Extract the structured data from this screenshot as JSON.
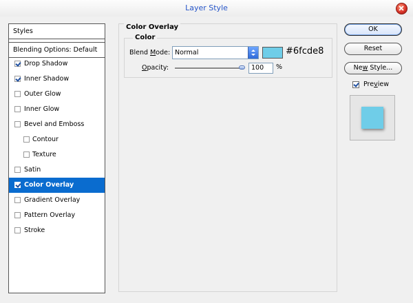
{
  "window": {
    "title": "Layer Style"
  },
  "styles_panel": {
    "header": "Styles",
    "blending_options": "Blending Options: Default",
    "items": [
      {
        "label": "Drop Shadow",
        "checked": true,
        "indent": false,
        "selected": false
      },
      {
        "label": "Inner Shadow",
        "checked": true,
        "indent": false,
        "selected": false
      },
      {
        "label": "Outer Glow",
        "checked": false,
        "indent": false,
        "selected": false
      },
      {
        "label": "Inner Glow",
        "checked": false,
        "indent": false,
        "selected": false
      },
      {
        "label": "Bevel and Emboss",
        "checked": false,
        "indent": false,
        "selected": false
      },
      {
        "label": "Contour",
        "checked": false,
        "indent": true,
        "selected": false
      },
      {
        "label": "Texture",
        "checked": false,
        "indent": true,
        "selected": false
      },
      {
        "label": "Satin",
        "checked": false,
        "indent": false,
        "selected": false
      },
      {
        "label": "Color Overlay",
        "checked": true,
        "indent": false,
        "selected": true
      },
      {
        "label": "Gradient Overlay",
        "checked": false,
        "indent": false,
        "selected": false
      },
      {
        "label": "Pattern Overlay",
        "checked": false,
        "indent": false,
        "selected": false
      },
      {
        "label": "Stroke",
        "checked": false,
        "indent": false,
        "selected": false
      }
    ]
  },
  "color_overlay": {
    "section_title": "Color Overlay",
    "group_title": "Color",
    "blend_mode_label_pre": "Blend ",
    "blend_mode_label_u": "M",
    "blend_mode_label_post": "ode:",
    "blend_mode_value": "Normal",
    "color_hex": "#6fcde8",
    "color_text": "#6fcde8",
    "opacity_label_u": "O",
    "opacity_label_post": "pacity:",
    "opacity_value": "100",
    "opacity_fraction": 1.0,
    "opacity_unit": "%"
  },
  "buttons": {
    "ok": "OK",
    "reset": "Reset",
    "new_style_pre": "Ne",
    "new_style_u": "w",
    "new_style_post": " Style...",
    "preview_label_pre": "Pre",
    "preview_label_u": "v",
    "preview_label_post": "iew",
    "preview_checked": true
  },
  "colors": {
    "accent": "#0a6ccf",
    "title": "#2655c8",
    "overlay": "#6fcde8"
  }
}
